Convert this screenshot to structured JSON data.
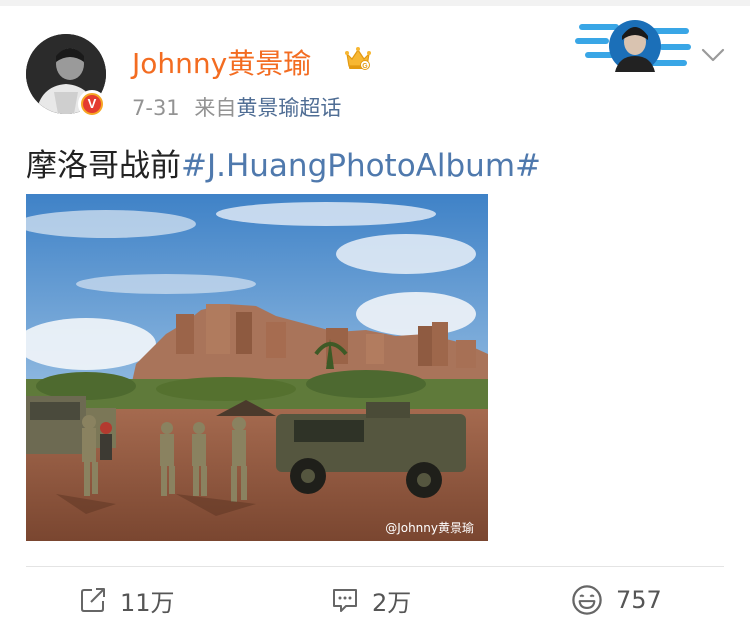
{
  "post": {
    "author": "Johnny黄景瑜",
    "date": "7-31",
    "source_prefix": "来自",
    "source": "黄景瑜超话",
    "text": "摩洛哥战前",
    "hashtag": "#J.HuangPhotoAlbum#",
    "photo_watermark": "@Johnny黄景瑜",
    "verified_badge": "V"
  },
  "actions": {
    "repost_count": "11万",
    "comment_count": "2万",
    "like_count": "757"
  },
  "colors": {
    "username": "#f36c21",
    "source_link": "#4f6d94",
    "hashtag": "#4f79ad",
    "verified_outer": "#f6a623",
    "verified_inner": "#e43b2f"
  },
  "icons": {
    "crown": "crown-icon",
    "chevron": "chevron-down-icon",
    "repost": "repost-icon",
    "comment": "comment-icon",
    "like": "smile-like-icon"
  }
}
